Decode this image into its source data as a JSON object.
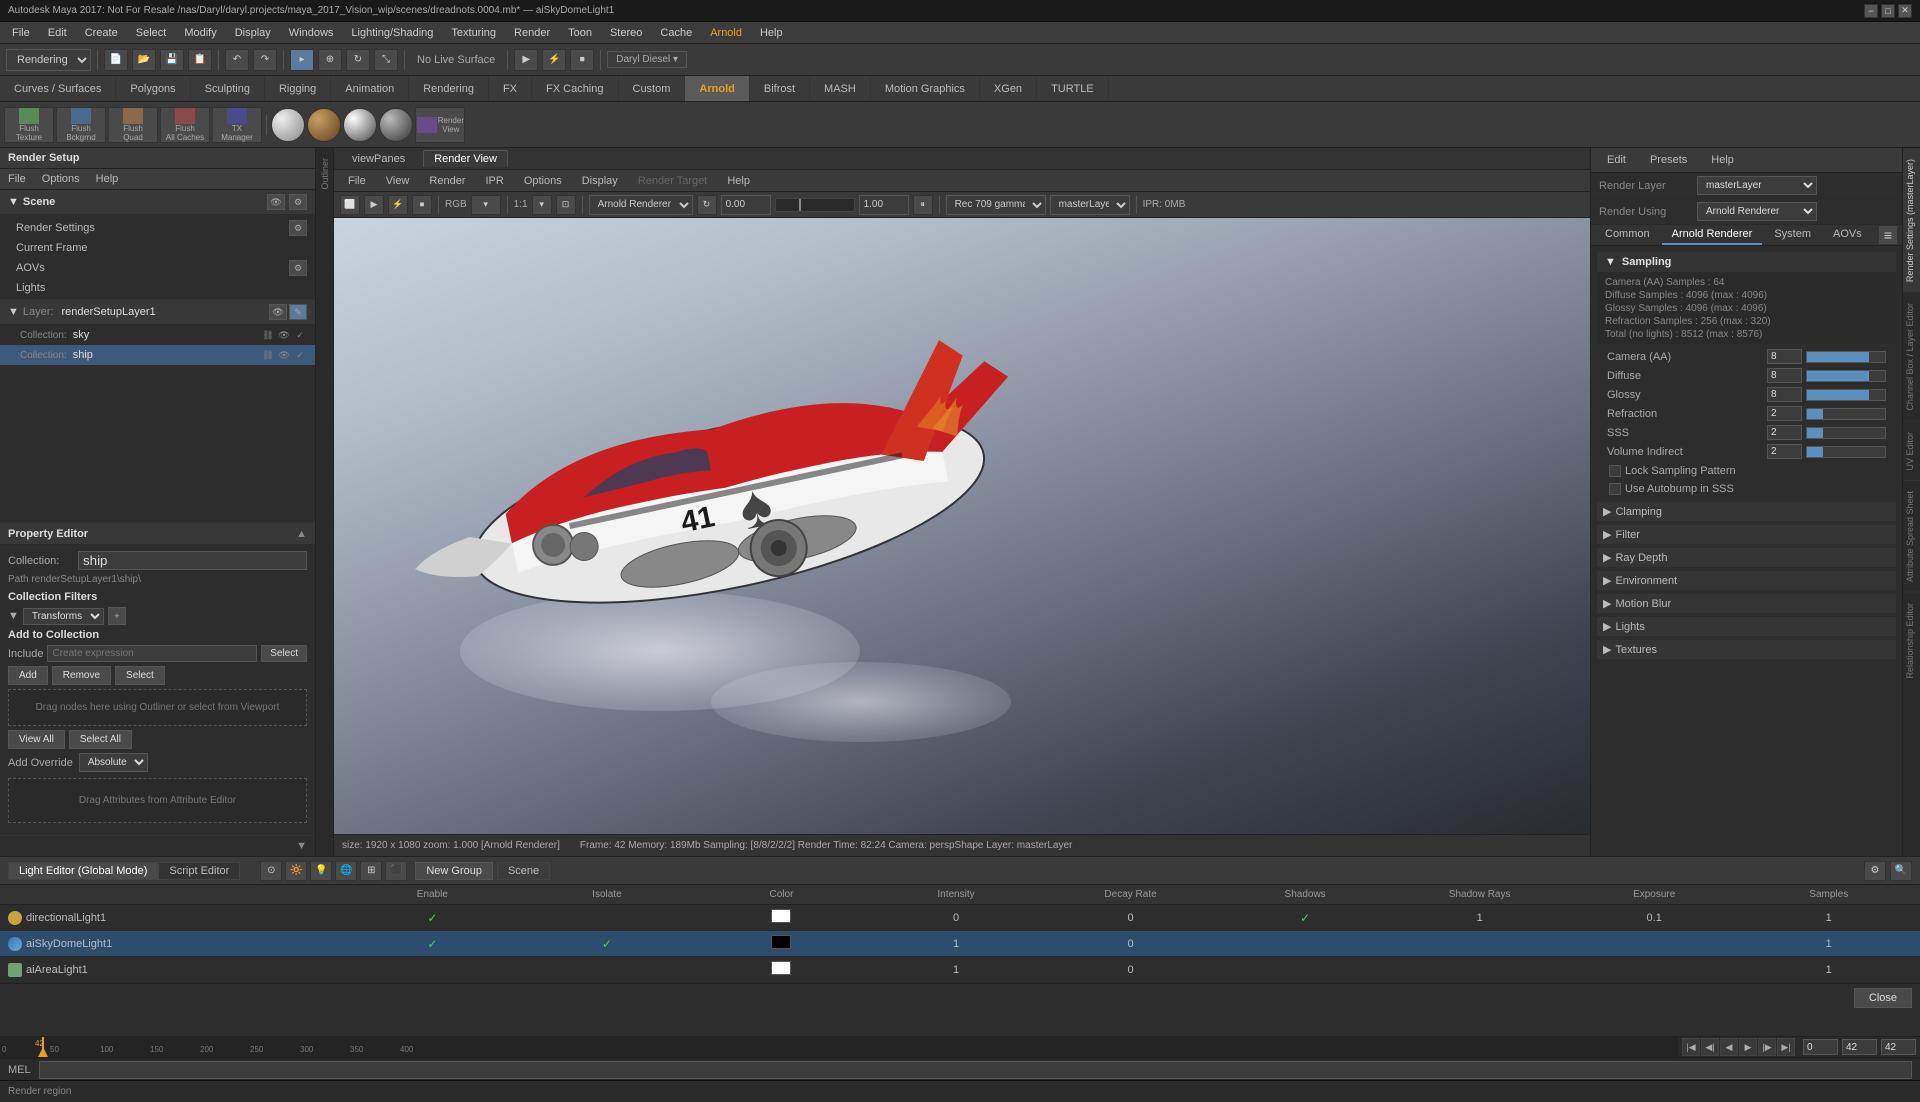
{
  "titlebar": {
    "title": "Autodesk Maya 2017: Not For Resale /nas/Daryl/daryl.projects/maya_2017_Vision_wip/scenes/dreadnots.0004.mb* — aiSkyDomeLight1",
    "controls": [
      "−",
      "□",
      "✕"
    ]
  },
  "menubar": {
    "items": [
      "File",
      "Edit",
      "Create",
      "Select",
      "Modify",
      "Display",
      "Windows",
      "Lighting/Shading",
      "Texturing",
      "Render",
      "Toon",
      "Stereo",
      "Cache",
      "Arnold",
      "Help"
    ]
  },
  "toolbar": {
    "renderer_dropdown": "Rendering",
    "no_live_surface": "No Live Surface"
  },
  "module_tabs": {
    "items": [
      "Curves / Surfaces",
      "Polygons",
      "Sculpting",
      "Rigging",
      "Animation",
      "Rendering",
      "FX",
      "FX Caching",
      "Custom",
      "Arnold",
      "Bifrost",
      "MASH",
      "Motion Graphics",
      "XGen",
      "TURTLE"
    ],
    "active": "Arnold"
  },
  "render_setup": {
    "title": "Render Setup",
    "menus": [
      "File",
      "Options",
      "Help"
    ],
    "scene_label": "Scene",
    "render_settings_label": "Render Settings",
    "current_frame_label": "Current Frame",
    "aovs_label": "AOVs",
    "lights_label": "Lights",
    "layer": {
      "label": "Layer:",
      "name": "renderSetupLayer1"
    },
    "collections": [
      {
        "label": "Collection:",
        "name": "sky",
        "selected": false
      },
      {
        "label": "Collection:",
        "name": "ship",
        "selected": true
      }
    ]
  },
  "property_editor": {
    "title": "Property Editor",
    "collection_label": "Collection:",
    "collection_name": "ship",
    "path": "Path renderSetupLayer1\\ship\\",
    "collection_filters_title": "Collection Filters",
    "filters_label": "▼",
    "transforms_label": "Transforms",
    "add_to_collection_title": "Add to Collection",
    "include_label": "Include",
    "include_placeholder": "Create expression",
    "select_btn": "Select",
    "add_btn": "Add",
    "remove_btn": "Remove",
    "select_btn2": "Select",
    "drag_hint": "Drag nodes here using Outliner or select from Viewport",
    "view_all_btn": "View All",
    "select_all_btn": "Select All",
    "add_override_label": "Add Override",
    "absolute_label": "Absolute",
    "attr_drag_hint": "Drag Attributes from Attribute Editor",
    "mel_label": "MEL"
  },
  "render_view": {
    "tab_label": "Render View",
    "toolbar": {
      "rgb_label": "RGB",
      "ratio_label": "1:1",
      "renderer": "Arnold Renderer",
      "value1": "0.00",
      "value2": "1.00",
      "gamma": "Rec 709 gamma",
      "layer": "masterLayer",
      "ipr": "IPR: 0MB"
    },
    "status": "Frame: 42  Memory: 189Mb  Sampling: [8/8/2/2/2]  Render Time: 82:24  Camera: perspShape  Layer: masterLayer",
    "size_info": "size: 1920 x 1080  zoom: 1.000  [Arnold Renderer]"
  },
  "arnold_settings": {
    "header": {
      "edit_label": "Edit",
      "presets_label": "Presets",
      "help_label": "Help",
      "render_layer_label": "Render Layer",
      "render_layer_value": "masterLayer",
      "render_using_label": "Render Using",
      "render_using_value": "Arnold Renderer"
    },
    "tabs": [
      "Common",
      "Arnold Renderer",
      "System",
      "AOVs"
    ],
    "active_tab": "Arnold Renderer",
    "sampling_title": "Sampling",
    "sampling_info": [
      {
        "label": "Camera (AA) Samples : 64",
        "value": ""
      },
      {
        "label": "Diffuse Samples : 4096 (max : 4096)",
        "value": ""
      },
      {
        "label": "Glossy Samples : 4096 (max : 4096)",
        "value": ""
      },
      {
        "label": "Refraction Samples : 256 (max : 320)",
        "value": ""
      },
      {
        "label": "Total (no lights) : 8512 (max : 8576)",
        "value": ""
      }
    ],
    "settings": [
      {
        "label": "Camera (AA)",
        "value": "8"
      },
      {
        "label": "Diffuse",
        "value": "8"
      },
      {
        "label": "Glossy",
        "value": "8"
      },
      {
        "label": "Refraction",
        "value": "2"
      },
      {
        "label": "SSS",
        "value": "2"
      },
      {
        "label": "Volume Indirect",
        "value": "2"
      }
    ],
    "lock_label": "Lock Sampling Pattern",
    "autobump_label": "Use Autobump in SSS",
    "sections": [
      "Clamping",
      "Filter",
      "Ray Depth",
      "Environment",
      "Motion Blur",
      "Lights",
      "Textures"
    ]
  },
  "light_editor": {
    "tab1": "Light Editor (Global Mode)",
    "tab2": "Script Editor",
    "new_group_btn": "New Group",
    "scene_btn": "Scene",
    "columns": [
      "Enable",
      "Isolate",
      "Color",
      "Intensity",
      "Decay Rate",
      "Shadows",
      "Shadow Rays",
      "Exposure",
      "Samples"
    ],
    "lights": [
      {
        "name": "directionalLight1",
        "type": "directional",
        "enable": true,
        "isolate": false,
        "color": "#ffffff",
        "intensity": "0",
        "decay_rate": "0",
        "shadows": true,
        "shadow_rays": "1",
        "exposure": "0.1",
        "samples": "1"
      },
      {
        "name": "aiSkyDomeLight1",
        "type": "sky",
        "enable": true,
        "isolate": true,
        "color": "#000000",
        "intensity": "1",
        "decay_rate": "0",
        "shadows": false,
        "shadow_rays": "",
        "exposure": "",
        "samples": "1"
      },
      {
        "name": "aiAreaLight1",
        "type": "area",
        "enable": false,
        "isolate": false,
        "color": "#ffffff",
        "intensity": "1",
        "decay_rate": "0",
        "shadows": false,
        "shadow_rays": "",
        "exposure": "",
        "samples": "1"
      }
    ],
    "close_btn": "Close"
  },
  "timeline": {
    "start": "0",
    "end": "42",
    "current": "42",
    "frame_start": "0",
    "frame_end": "42",
    "markers": [
      "0",
      "50",
      "100",
      "150",
      "200",
      "250",
      "300",
      "350",
      "400"
    ]
  },
  "mel_bar": {
    "label": "MEL"
  },
  "status_bar": {
    "message": "Render region"
  },
  "vertical_side_tabs": [
    "Render Settings (masterLayer)",
    "Channel Box / Layer Editor",
    "UV Editor",
    "Attribute Spread Sheet",
    "Relationship Editor"
  ]
}
